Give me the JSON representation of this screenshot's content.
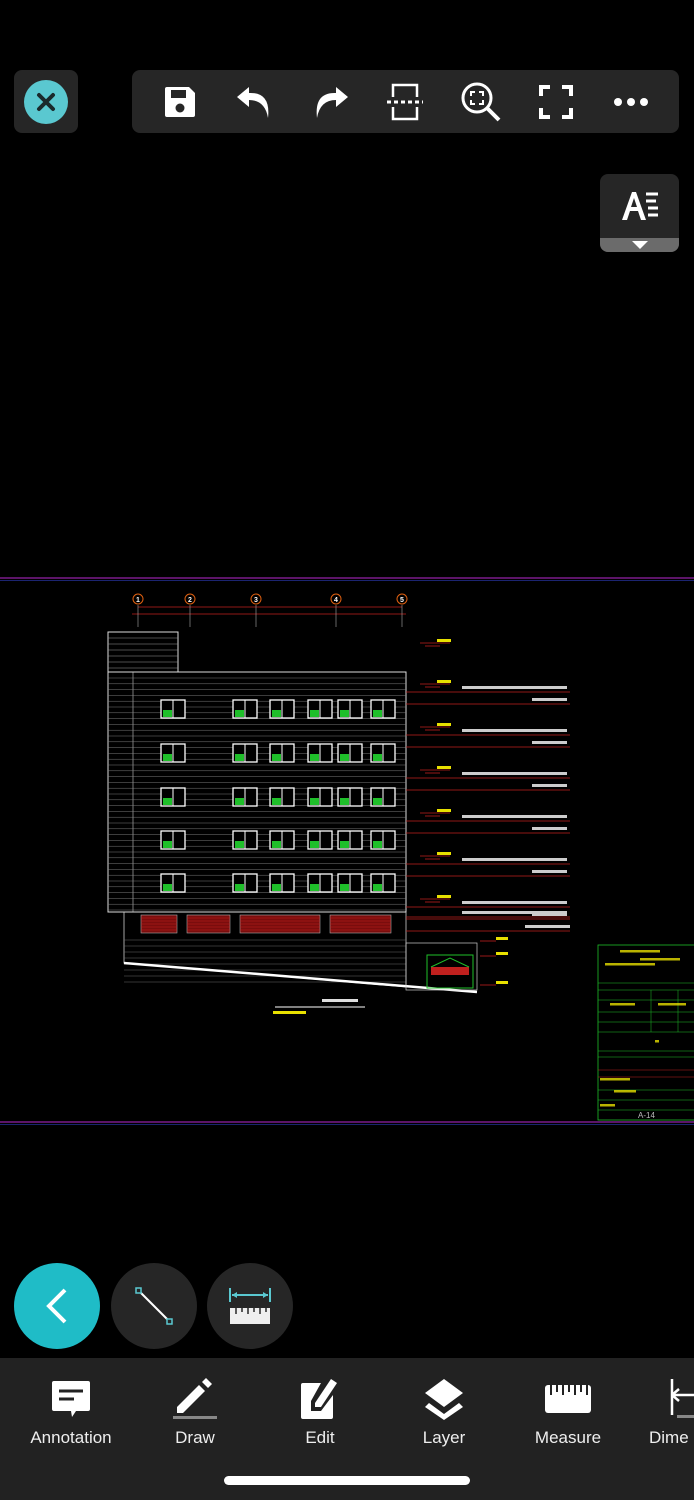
{
  "toolbar": {
    "icons": [
      "close-icon",
      "save-icon",
      "undo-icon",
      "redo-icon",
      "section-icon",
      "zoom-extents-icon",
      "fullscreen-icon",
      "more-icon"
    ]
  },
  "text_style": {
    "icon": "text-style-icon"
  },
  "drawing": {
    "grid_labels": [
      "1",
      "2",
      "3",
      "4",
      "5"
    ],
    "sheet_number": "A-14"
  },
  "fabs": {
    "icons": [
      "back-icon",
      "line-icon",
      "measure-distance-icon"
    ]
  },
  "bottom_tabs": [
    {
      "label": "Annotation",
      "icon": "annotation-icon"
    },
    {
      "label": "Draw",
      "icon": "pencil-icon"
    },
    {
      "label": "Edit",
      "icon": "edit-icon"
    },
    {
      "label": "Layer",
      "icon": "layers-icon"
    },
    {
      "label": "Measure",
      "icon": "ruler-icon"
    },
    {
      "label": "Dime",
      "icon": "dimension-icon"
    }
  ],
  "colors": {
    "accent": "#5ac8d0",
    "panel": "#262626",
    "cad_red": "#c0201e",
    "cad_green": "#1fbf2a",
    "cad_yellow": "#e8e000",
    "limit_line": "#7a1a8a"
  }
}
